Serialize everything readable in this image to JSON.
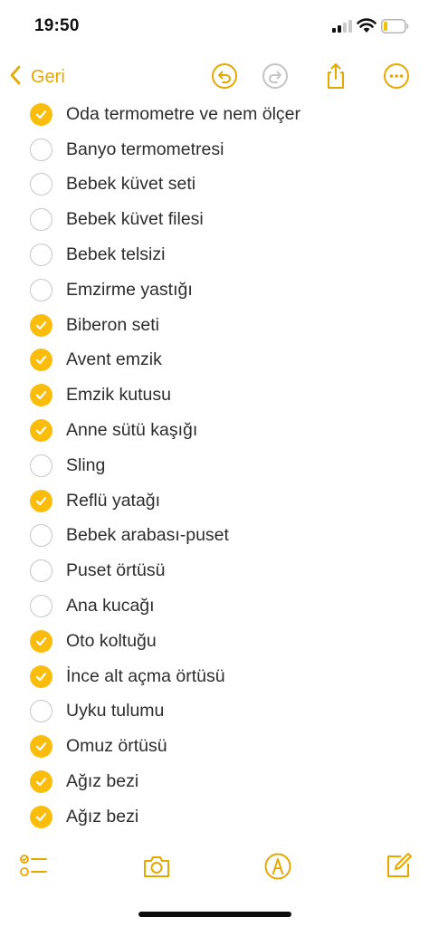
{
  "status_bar": {
    "time": "19:50",
    "icons": [
      "cellular-signal-icon",
      "wifi-icon",
      "battery-icon"
    ]
  },
  "nav": {
    "back_label": "Geri",
    "icons": [
      "undo-icon",
      "redo-icon",
      "share-icon",
      "more-icon"
    ]
  },
  "accent_color": "#FBBD0B",
  "checklist": [
    {
      "label": "Oda termometre ve nem ölçer",
      "checked": true
    },
    {
      "label": "Banyo termometresi",
      "checked": false
    },
    {
      "label": "Bebek küvet seti",
      "checked": false
    },
    {
      "label": "Bebek küvet filesi",
      "checked": false
    },
    {
      "label": "Bebek telsizi",
      "checked": false
    },
    {
      "label": "Emzirme yastığı",
      "checked": false
    },
    {
      "label": "Biberon seti",
      "checked": true
    },
    {
      "label": "Avent emzik",
      "checked": true
    },
    {
      "label": "Emzik kutusu",
      "checked": true
    },
    {
      "label": "Anne sütü kaşığı",
      "checked": true
    },
    {
      "label": "Sling",
      "checked": false
    },
    {
      "label": "Reflü yatağı",
      "checked": true
    },
    {
      "label": "Bebek arabası-puset",
      "checked": false
    },
    {
      "label": "Puset örtüsü",
      "checked": false
    },
    {
      "label": "Ana kucağı",
      "checked": false
    },
    {
      "label": "Oto koltuğu",
      "checked": true
    },
    {
      "label": "İnce alt açma örtüsü",
      "checked": true
    },
    {
      "label": "Uyku tulumu",
      "checked": false
    },
    {
      "label": "Omuz örtüsü",
      "checked": true
    },
    {
      "label": "Ağız bezi",
      "checked": true
    },
    {
      "label": "Ağız bezi",
      "checked": true
    }
  ],
  "toolbar": {
    "icons": [
      "checklist-icon",
      "camera-icon",
      "markup-pen-icon",
      "compose-icon"
    ]
  }
}
